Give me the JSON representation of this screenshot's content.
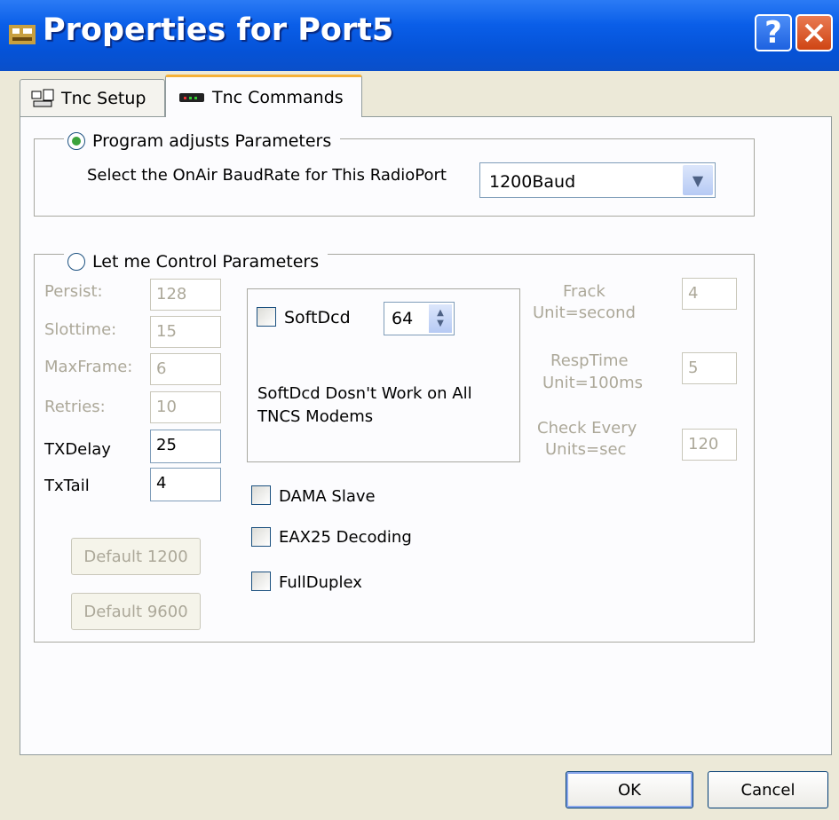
{
  "window": {
    "title": "Properties for Port5"
  },
  "tabs": [
    {
      "label": "Tnc Setup"
    },
    {
      "label": "Tnc Commands"
    }
  ],
  "program_group": {
    "radio_label": "Program adjusts Parameters",
    "baud_label": "Select the OnAir BaudRate for This RadioPort",
    "baud_value": "1200Baud"
  },
  "control_group": {
    "radio_label": "Let me Control Parameters",
    "persist": {
      "label": "Persist:",
      "value": "128"
    },
    "slottime": {
      "label": "Slottime:",
      "value": "15"
    },
    "maxframe": {
      "label": "MaxFrame:",
      "value": "6"
    },
    "retries": {
      "label": "Retries:",
      "value": "10"
    },
    "txdelay": {
      "label": "TXDelay",
      "value": "25"
    },
    "txtail": {
      "label": "TxTail",
      "value": "4"
    },
    "default1200": "Default 1200",
    "default9600": "Default 9600"
  },
  "softdcd": {
    "label": "SoftDcd",
    "value": "64",
    "note_line1": "SoftDcd Dosn't Work on All",
    "note_line2": "TNCS  Modems"
  },
  "options": {
    "dama": "DAMA Slave",
    "eax25": "EAX25 Decoding",
    "fullduplex": "FullDuplex"
  },
  "timers": {
    "frack_line1": "Frack",
    "frack_line2": "Unit=second",
    "frack_value": "4",
    "resp_line1": "RespTime",
    "resp_line2": "Unit=100ms",
    "resp_value": "5",
    "check_line1": "Check Every",
    "check_line2": "Units=sec",
    "check_value": "120"
  },
  "buttons": {
    "ok": "OK",
    "cancel": "Cancel"
  }
}
